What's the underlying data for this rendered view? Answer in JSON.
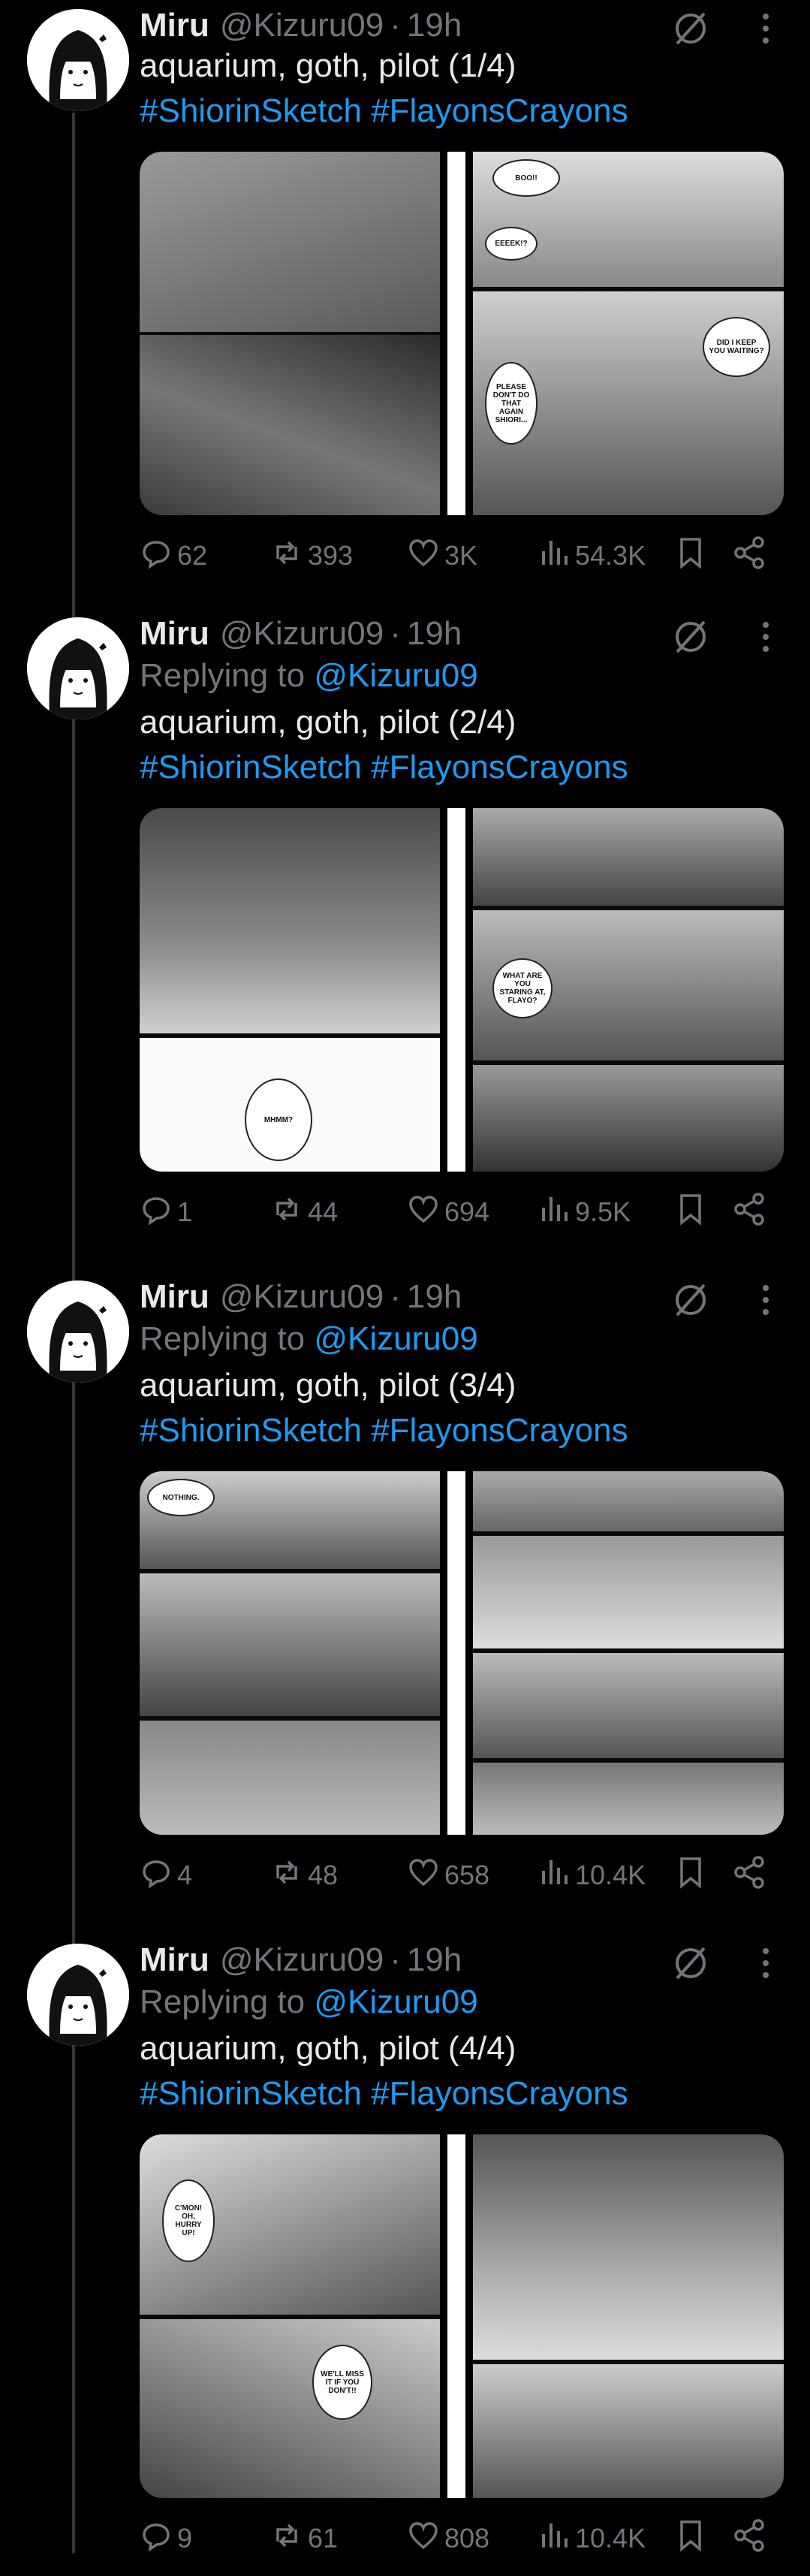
{
  "tweets": [
    {
      "author": "Miru",
      "handle": "@Kizuru09",
      "time": "19h",
      "replying": false,
      "replying_label": "",
      "replying_handle": "",
      "text": "aquarium, goth, pilot (1/4)",
      "hashtags": [
        "#ShiorinSketch",
        "#FlayonsCrayons"
      ],
      "stats": {
        "replies": "62",
        "reposts": "393",
        "likes": "3K",
        "views": "54.3K"
      }
    },
    {
      "author": "Miru",
      "handle": "@Kizuru09",
      "time": "19h",
      "replying": true,
      "replying_label": "Replying to",
      "replying_handle": "@Kizuru09",
      "text": "aquarium, goth, pilot (2/4)",
      "hashtags": [
        "#ShiorinSketch",
        "#FlayonsCrayons"
      ],
      "stats": {
        "replies": "1",
        "reposts": "44",
        "likes": "694",
        "views": "9.5K"
      }
    },
    {
      "author": "Miru",
      "handle": "@Kizuru09",
      "time": "19h",
      "replying": true,
      "replying_label": "Replying to",
      "replying_handle": "@Kizuru09",
      "text": "aquarium, goth, pilot (3/4)",
      "hashtags": [
        "#ShiorinSketch",
        "#FlayonsCrayons"
      ],
      "stats": {
        "replies": "4",
        "reposts": "48",
        "likes": "658",
        "views": "10.4K"
      }
    },
    {
      "author": "Miru",
      "handle": "@Kizuru09",
      "time": "19h",
      "replying": true,
      "replying_label": "Replying to",
      "replying_handle": "@Kizuru09",
      "text": "aquarium, goth, pilot (4/4)",
      "hashtags": [
        "#ShiorinSketch",
        "#FlayonsCrayons"
      ],
      "stats": {
        "replies": "9",
        "reposts": "61",
        "likes": "808",
        "views": "10.4K"
      }
    }
  ],
  "manga_speech": {
    "t1": [
      "BOO!!",
      "EEEEK!?",
      "DID I KEEP YOU WAITING?",
      "PLEASE DON'T DO THAT AGAIN SHIORI..."
    ],
    "t2": [
      "WHAT ARE YOU STARING AT, FLAYO?",
      "MHMM?"
    ],
    "t3": [
      "NOTHING."
    ],
    "t4": [
      "C'MON! OH, HURRY UP!",
      "WE'LL MISS IT IF YOU DON'T!!"
    ]
  },
  "colors": {
    "background": "#000000",
    "text": "#e7e9ea",
    "muted": "#71767b",
    "link": "#1d9bf0",
    "thread_line": "#333639"
  },
  "icons": [
    "grok-icon",
    "more-icon",
    "reply-icon",
    "repost-icon",
    "like-icon",
    "views-icon",
    "bookmark-icon",
    "share-icon"
  ]
}
